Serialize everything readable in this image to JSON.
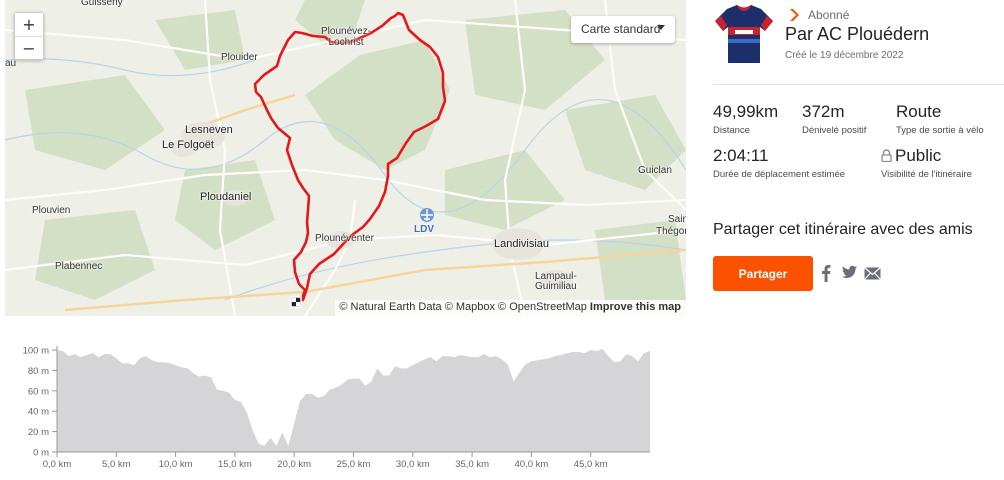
{
  "map": {
    "style_selector": "Carte standard",
    "zoom_in": "+",
    "zoom_out": "−",
    "attribution": "© Natural Earth Data © Mapbox © OpenStreetMap",
    "improve_link": "Improve this map",
    "places": {
      "guisseny": "Guisseny",
      "plounevez": "Plounévez-\nLochrist",
      "plouider": "Plouider",
      "au": "au",
      "lesneven": "Lesneven",
      "lefolgoet": "Le Folgoët",
      "guiclan": "Guiclan",
      "ploudaniel": "Ploudaniel",
      "plouvien": "Plouvien",
      "ldv": "LDV",
      "plounventer": "Plounéventer",
      "saint": "Sain",
      "thegon": "Thégon",
      "landivisiau": "Landivisiau",
      "plabennec": "Plabennec",
      "lampaul": "Lampaul-\nGuimiliau"
    },
    "colors": {
      "route": "#e5171c",
      "land": "#eef0e8",
      "forest": "#d7e2ca"
    }
  },
  "route": {
    "subscription": "Abonné",
    "title": "Par AC Plouédern",
    "created": "Créé le 19 décembre 2022",
    "accent": "#fc5200",
    "stats": {
      "distance": {
        "value": "49,99km",
        "label": "Distance"
      },
      "elevation": {
        "value": "372m",
        "label": "Dénivelé positif"
      },
      "type": {
        "value": "Route",
        "label": "Type de sortie à vélo"
      },
      "duration": {
        "value": "2:04:11",
        "label": "Durée de déplacement estimée"
      },
      "visibility": {
        "value": "Public",
        "label": "Visibilité de l'itinéraire"
      }
    },
    "share_heading": "Partager cet itinéraire avec des amis",
    "share_button": "Partager",
    "social": [
      "facebook-icon",
      "twitter-icon",
      "email-icon"
    ]
  },
  "chart_data": {
    "type": "area",
    "title": "",
    "xlabel": "",
    "ylabel": "",
    "xlim": [
      0,
      50
    ],
    "ylim": [
      0,
      100
    ],
    "x_ticks": [
      "0,0 km",
      "5,0 km",
      "10,0 km",
      "15,0 km",
      "20,0 km",
      "25,0 km",
      "30,0 km",
      "35,0 km",
      "40,0 km",
      "45,0 km"
    ],
    "y_ticks": [
      "0 m",
      "20 m",
      "40 m",
      "60 m",
      "80 m",
      "100 m"
    ],
    "grid": true,
    "fill_color": "#d5d5d7",
    "series": [
      {
        "x": [
          0,
          0.5,
          1,
          1.5,
          2,
          2.5,
          3,
          3.5,
          4,
          4.5,
          5,
          5.5,
          6,
          6.5,
          7,
          7.5,
          8,
          8.5,
          9,
          9.5,
          10,
          10.5,
          11,
          11.5,
          12,
          12.5,
          13,
          13.5,
          14,
          14.5,
          15,
          15.5,
          16,
          16.5,
          17,
          17.5,
          18,
          18.5,
          19,
          19.5,
          20,
          20.5,
          21,
          21.5,
          22,
          22.5,
          23,
          23.5,
          24,
          24.5,
          25,
          25.5,
          26,
          26.5,
          27,
          27.5,
          28,
          28.5,
          29,
          29.5,
          30,
          30.5,
          31,
          31.5,
          32,
          32.5,
          33,
          33.5,
          34,
          34.5,
          35,
          35.5,
          36,
          36.5,
          37,
          37.5,
          38,
          38.5,
          39,
          39.5,
          40,
          40.5,
          41,
          41.5,
          42,
          42.5,
          43,
          43.5,
          44,
          44.5,
          45,
          45.5,
          46,
          46.5,
          47,
          47.5,
          48,
          48.5,
          49,
          49.5,
          50
        ],
        "y": [
          100,
          99,
          94,
          96,
          93,
          95,
          97,
          93,
          96,
          96,
          92,
          87,
          87,
          85,
          92,
          94,
          90,
          88,
          88,
          87,
          85,
          83,
          82,
          77,
          74,
          75,
          73,
          61,
          60,
          58,
          51,
          49,
          39,
          21,
          8,
          6,
          14,
          6,
          19,
          6,
          28,
          50,
          57,
          57,
          53,
          55,
          61,
          63,
          66,
          71,
          72,
          72,
          65,
          69,
          82,
          75,
          75,
          84,
          82,
          82,
          85,
          88,
          91,
          93,
          89,
          94,
          94,
          93,
          95,
          94,
          93,
          93,
          96,
          93,
          94,
          91,
          86,
          69,
          78,
          86,
          89,
          90,
          91,
          92,
          94,
          95,
          97,
          98,
          98,
          97,
          100,
          99,
          101,
          94,
          88,
          89,
          96,
          94,
          89,
          97,
          99
        ]
      }
    ]
  }
}
